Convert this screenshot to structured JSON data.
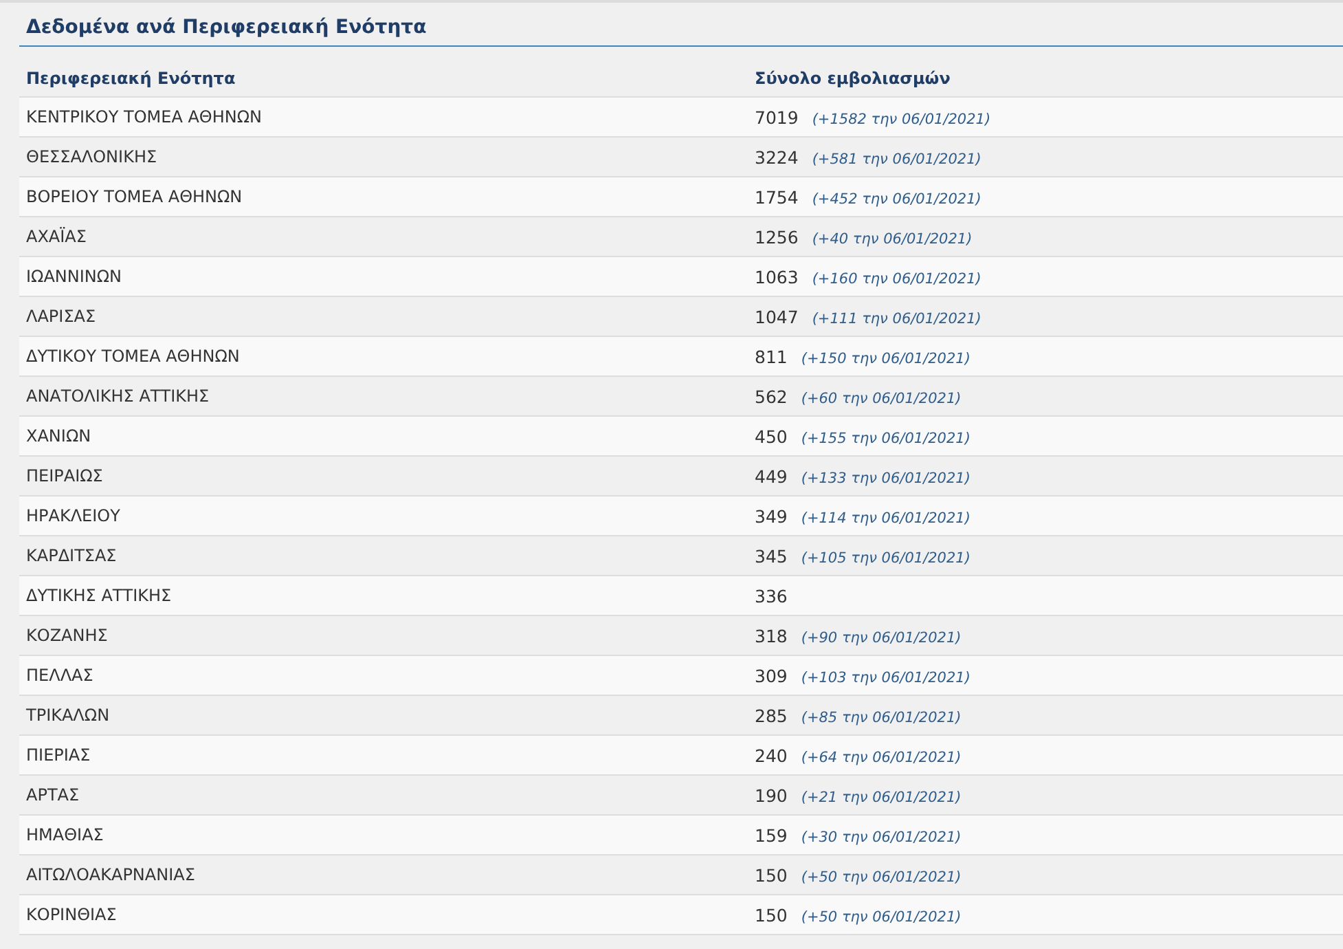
{
  "title": "Δεδομένα ανά Περιφερειακή Ενότητα",
  "table": {
    "columns": [
      "Περιφερειακή Ενότητα",
      "Σύνολο εμβολιασμών"
    ],
    "rows": [
      {
        "region": "ΚΕΝΤΡΙΚΟΥ ΤΟΜΕΑ ΑΘΗΝΩΝ",
        "total": "7019",
        "change": "(+1582 την 06/01/2021)"
      },
      {
        "region": "ΘΕΣΣΑΛΟΝΙΚΗΣ",
        "total": "3224",
        "change": "(+581 την 06/01/2021)"
      },
      {
        "region": "ΒΟΡΕΙΟΥ ΤΟΜΕΑ ΑΘΗΝΩΝ",
        "total": "1754",
        "change": "(+452 την 06/01/2021)"
      },
      {
        "region": "ΑΧΑΪΑΣ",
        "total": "1256",
        "change": "(+40 την 06/01/2021)"
      },
      {
        "region": "ΙΩΑΝΝΙΝΩΝ",
        "total": "1063",
        "change": "(+160 την 06/01/2021)"
      },
      {
        "region": "ΛΑΡΙΣΑΣ",
        "total": "1047",
        "change": "(+111 την 06/01/2021)"
      },
      {
        "region": "ΔΥΤΙΚΟΥ ΤΟΜΕΑ ΑΘΗΝΩΝ",
        "total": "811",
        "change": "(+150 την 06/01/2021)"
      },
      {
        "region": "ΑΝΑΤΟΛΙΚΗΣ ΑΤΤΙΚΗΣ",
        "total": "562",
        "change": "(+60 την 06/01/2021)"
      },
      {
        "region": "ΧΑΝΙΩΝ",
        "total": "450",
        "change": "(+155 την 06/01/2021)"
      },
      {
        "region": "ΠΕΙΡΑΙΩΣ",
        "total": "449",
        "change": "(+133 την 06/01/2021)"
      },
      {
        "region": "ΗΡΑΚΛΕΙΟΥ",
        "total": "349",
        "change": "(+114 την 06/01/2021)"
      },
      {
        "region": "ΚΑΡΔΙΤΣΑΣ",
        "total": "345",
        "change": "(+105 την 06/01/2021)"
      },
      {
        "region": "ΔΥΤΙΚΗΣ ΑΤΤΙΚΗΣ",
        "total": "336"
      },
      {
        "region": "ΚΟΖΑΝΗΣ",
        "total": "318",
        "change": "(+90 την 06/01/2021)"
      },
      {
        "region": "ΠΕΛΛΑΣ",
        "total": "309",
        "change": "(+103 την 06/01/2021)"
      },
      {
        "region": "ΤΡΙΚΑΛΩΝ",
        "total": "285",
        "change": "(+85 την 06/01/2021)"
      },
      {
        "region": "ΠΙΕΡΙΑΣ",
        "total": "240",
        "change": "(+64 την 06/01/2021)"
      },
      {
        "region": "ΑΡΤΑΣ",
        "total": "190",
        "change": "(+21 την 06/01/2021)"
      },
      {
        "region": "ΗΜΑΘΙΑΣ",
        "total": "159",
        "change": "(+30 την 06/01/2021)"
      },
      {
        "region": "ΑΙΤΩΛΟΑΚΑΡΝΑΝΙΑΣ",
        "total": "150",
        "change": "(+50 την 06/01/2021)"
      },
      {
        "region": "ΚΟΡΙΝΘΙΑΣ",
        "total": "150",
        "change": "(+50 την 06/01/2021)"
      }
    ]
  }
}
